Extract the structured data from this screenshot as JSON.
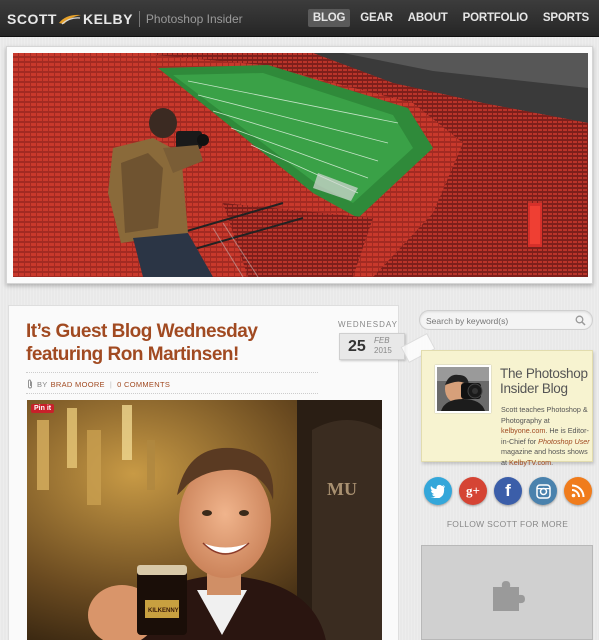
{
  "header": {
    "logo_first": "SCOTT",
    "logo_last": "KELBY",
    "tagline": "Photoshop Insider",
    "nav": [
      {
        "label": "BLOG",
        "active": true
      },
      {
        "label": "GEAR",
        "active": false
      },
      {
        "label": "ABOUT",
        "active": false
      },
      {
        "label": "PORTFOLIO",
        "active": false
      },
      {
        "label": "SPORTS",
        "active": false
      }
    ]
  },
  "post": {
    "title": "It’s Guest Blog Wednesday featuring Ron Martinsen!",
    "date": {
      "weekday": "WEDNESDAY",
      "day": "25",
      "month": "FEB",
      "year": "2015"
    },
    "meta": {
      "by": "BY",
      "author": "BRAD MOORE",
      "separator": "|",
      "comments": "0 COMMENTS"
    },
    "pin_label": "Pin it"
  },
  "sidebar": {
    "search_placeholder": "Search by keyword(s)",
    "about": {
      "title": "The Photoshop Insider Blog",
      "text_1": "Scott teaches Photoshop & Photography at ",
      "link_1": "kelbyone.com",
      "text_2": ". He is Editor-in-Chief for ",
      "magazine": "Photoshop User",
      "text_3": " magazine and hosts shows at ",
      "link_2": "KelbyTV.com",
      "text_4": "."
    },
    "social": [
      {
        "name": "twitter",
        "color": "#34a7da"
      },
      {
        "name": "google-plus",
        "color": "#d54434"
      },
      {
        "name": "facebook",
        "color": "#3b5ea9"
      },
      {
        "name": "instagram",
        "color": "#4a82ad"
      },
      {
        "name": "rss",
        "color": "#f07c1c"
      }
    ],
    "follow_text": "FOLLOW SCOTT FOR MORE"
  },
  "colors": {
    "accent": "#a14a21",
    "topbar": "#2f2f2f",
    "note": "#f7f3d0"
  }
}
